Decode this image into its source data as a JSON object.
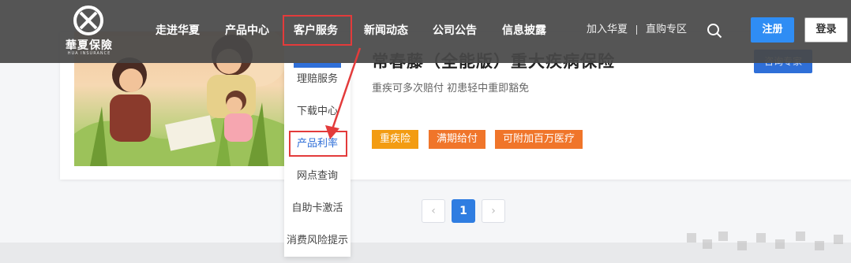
{
  "header": {
    "logo_text": "華夏保險",
    "logo_subtext": "HUA INSURANCE",
    "nav": [
      {
        "label": "走进华夏"
      },
      {
        "label": "产品中心"
      },
      {
        "label": "客户服务"
      },
      {
        "label": "新闻动态"
      },
      {
        "label": "公司公告"
      },
      {
        "label": "信息披露"
      }
    ],
    "top_links": [
      {
        "label": "加入华夏"
      },
      {
        "label": "直购专区"
      }
    ],
    "divider": "I",
    "register_label": "注册",
    "login_label": "登录"
  },
  "dropdown": {
    "items": [
      {
        "label": "理赔服务"
      },
      {
        "label": "下载中心"
      },
      {
        "label": "产品利率"
      },
      {
        "label": "网点查询"
      },
      {
        "label": "自助卡激活"
      },
      {
        "label": "消费风险提示"
      }
    ]
  },
  "product": {
    "title": "常春藤（全能版）重大疾病保险",
    "subtitle": "重疾可多次赔付 初患轻中重即豁免",
    "tags": [
      {
        "label": "重疾险"
      },
      {
        "label": "满期给付"
      },
      {
        "label": "可附加百万医疗"
      }
    ],
    "consult_label": "咨询专家"
  },
  "pagination": {
    "prev": "‹",
    "current": "1",
    "next": "›"
  },
  "colors": {
    "header_bg": "#484848",
    "primary_blue": "#2f6fd8",
    "register_blue": "#2f8df4",
    "highlight_red": "#e33b3b",
    "tag_orange": "#f39c12",
    "tag_orange_dark": "#f0752a"
  },
  "icons": [
    "logo-icon",
    "search-icon",
    "annotation-arrow-icon"
  ]
}
